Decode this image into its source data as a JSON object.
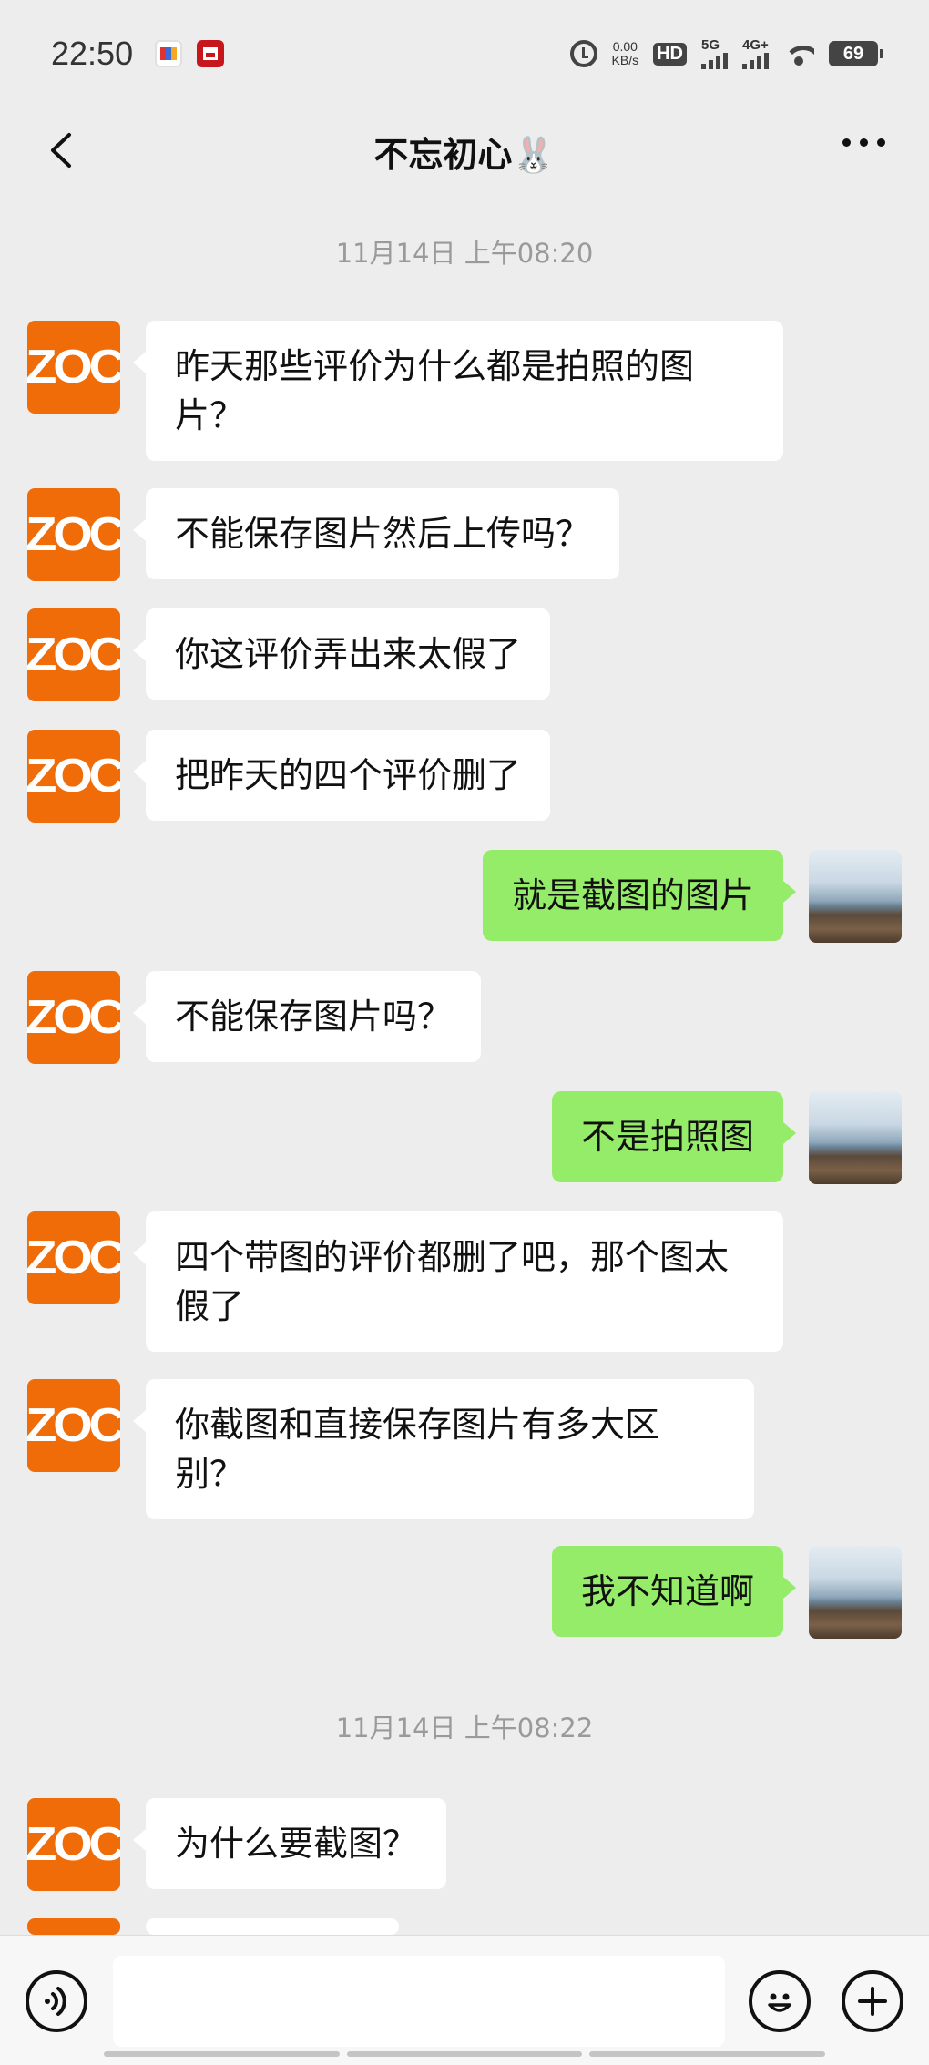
{
  "status_bar": {
    "time": "22:50",
    "network_speed": "0.00",
    "network_unit": "KB/s",
    "hd_label": "HD",
    "sim1": "5G",
    "sim2": "4G+",
    "battery": "69"
  },
  "header": {
    "title": "不忘初心🐰",
    "back_icon": "chevron-left-icon",
    "more_icon": "more-dots-icon"
  },
  "chat": {
    "contact_avatar_text": "ZOC",
    "timestamps": [
      "11月14日 上午08:20",
      "11月14日 上午08:22"
    ],
    "messages": [
      {
        "side": "in",
        "text": "昨天那些评价为什么都是拍照的图片？"
      },
      {
        "side": "in",
        "text": "不能保存图片然后上传吗？"
      },
      {
        "side": "in",
        "text": "你这评价弄出来太假了"
      },
      {
        "side": "in",
        "text": "把昨天的四个评价删了"
      },
      {
        "side": "out",
        "text": "就是截图的图片"
      },
      {
        "side": "in",
        "text": "不能保存图片吗？"
      },
      {
        "side": "out",
        "text": "不是拍照图"
      },
      {
        "side": "in",
        "text": "四个带图的评价都删了吧，那个图太假了"
      },
      {
        "side": "in",
        "text": "你截图和直接保存图片有多大区别？"
      },
      {
        "side": "out",
        "text": "我不知道啊"
      },
      {
        "side": "in",
        "text": "为什么要截图？"
      }
    ]
  },
  "input_bar": {
    "placeholder": "",
    "voice_icon": "voice-icon",
    "emoji_icon": "emoji-icon",
    "plus_icon": "plus-icon"
  }
}
